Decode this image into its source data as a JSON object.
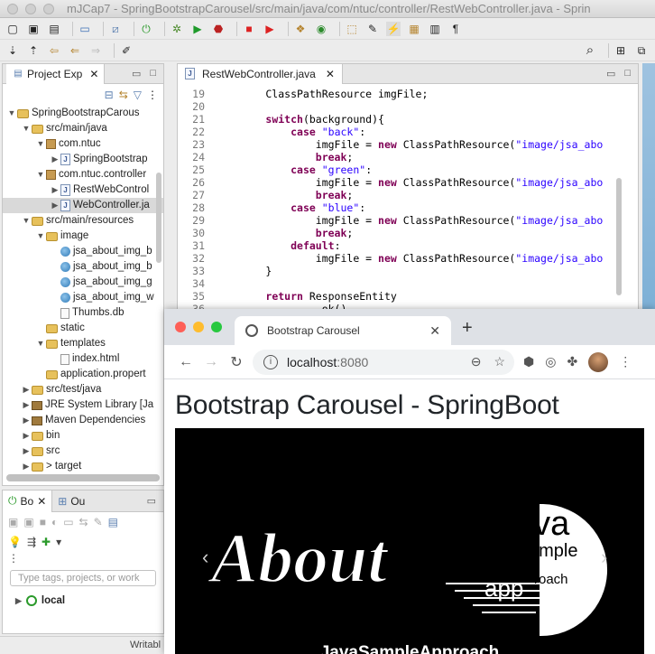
{
  "eclipse": {
    "window_title": "mJCap7 - SpringBootstrapCarousel/src/main/java/com/ntuc/controller/RestWebController.java - Sprin",
    "project_explorer": {
      "tab_label": "Project Exp",
      "items": [
        {
          "label": "SpringBootstrapCarous",
          "prefix": "> ",
          "level": 0,
          "expanded": true,
          "icon": "project-icon"
        },
        {
          "label": "src/main/java",
          "level": 1,
          "expanded": true,
          "icon": "source-folder-icon"
        },
        {
          "label": "com.ntuc",
          "level": 2,
          "expanded": true,
          "icon": "package-icon"
        },
        {
          "label": "SpringBootstrap",
          "level": 3,
          "expanded": false,
          "icon": "java-file-icon"
        },
        {
          "label": "com.ntuc.controller",
          "level": 2,
          "expanded": true,
          "icon": "package-icon"
        },
        {
          "label": "RestWebControl",
          "level": 3,
          "expanded": false,
          "icon": "java-file-icon"
        },
        {
          "label": "WebController.ja",
          "level": 3,
          "expanded": false,
          "icon": "java-file-icon",
          "selected": true
        },
        {
          "label": "src/main/resources",
          "level": 1,
          "expanded": true,
          "icon": "source-folder-icon"
        },
        {
          "label": "image",
          "level": 2,
          "expanded": true,
          "icon": "folder-icon"
        },
        {
          "label": "jsa_about_img_b",
          "level": 3,
          "icon": "image-file-icon"
        },
        {
          "label": "jsa_about_img_b",
          "level": 3,
          "icon": "image-file-icon"
        },
        {
          "label": "jsa_about_img_g",
          "level": 3,
          "icon": "image-file-icon"
        },
        {
          "label": "jsa_about_img_w",
          "level": 3,
          "icon": "image-file-icon"
        },
        {
          "label": "Thumbs.db",
          "level": 3,
          "icon": "db-file-icon"
        },
        {
          "label": "static",
          "level": 2,
          "icon": "folder-icon"
        },
        {
          "label": "templates",
          "level": 2,
          "expanded": true,
          "icon": "folder-icon"
        },
        {
          "label": "index.html",
          "level": 3,
          "icon": "html-file-icon"
        },
        {
          "label": "application.propert",
          "level": 2,
          "icon": "properties-icon"
        },
        {
          "label": "src/test/java",
          "level": 1,
          "expanded": false,
          "icon": "source-folder-icon"
        },
        {
          "label": "JRE System Library [Ja",
          "level": 1,
          "expanded": false,
          "icon": "library-icon"
        },
        {
          "label": "Maven Dependencies",
          "level": 1,
          "expanded": false,
          "icon": "library-icon"
        },
        {
          "label": "bin",
          "level": 1,
          "expanded": false,
          "icon": "folder-icon"
        },
        {
          "label": "src",
          "level": 1,
          "expanded": false,
          "icon": "folder-icon"
        },
        {
          "label": "> target",
          "level": 1,
          "expanded": false,
          "icon": "folder-icon"
        }
      ]
    },
    "boot_dashboard": {
      "tab_label": "Bo",
      "outline_tab_label": "Ou",
      "search_placeholder": "Type tags, projects, or work",
      "local_label": "local"
    },
    "status": "Writabl",
    "editor": {
      "tab_label": "RestWebController.java",
      "lines": [
        {
          "n": "19",
          "code": "        ClassPathResource imgFile;"
        },
        {
          "n": "20",
          "code": ""
        },
        {
          "n": "21",
          "code": "        switch(background){"
        },
        {
          "n": "22",
          "code": "            case \"back\":"
        },
        {
          "n": "23",
          "code": "                imgFile = new ClassPathResource(\"image/jsa_abo"
        },
        {
          "n": "24",
          "code": "                break;"
        },
        {
          "n": "25",
          "code": "            case \"green\":"
        },
        {
          "n": "26",
          "code": "                imgFile = new ClassPathResource(\"image/jsa_abo"
        },
        {
          "n": "27",
          "code": "                break;"
        },
        {
          "n": "28",
          "code": "            case \"blue\":"
        },
        {
          "n": "29",
          "code": "                imgFile = new ClassPathResource(\"image/jsa_abo"
        },
        {
          "n": "30",
          "code": "                break;"
        },
        {
          "n": "31",
          "code": "            default:"
        },
        {
          "n": "32",
          "code": "                imgFile = new ClassPathResource(\"image/jsa_abo"
        },
        {
          "n": "33",
          "code": "        }"
        },
        {
          "n": "34",
          "code": ""
        },
        {
          "n": "35",
          "code": "        return ResponseEntity"
        },
        {
          "n": "36",
          "code": "                .ok()"
        }
      ],
      "keywords": [
        "switch",
        "case",
        "new",
        "break",
        "default",
        "return"
      ]
    }
  },
  "chrome": {
    "tab_title": "Bootstrap Carousel",
    "url_host": "localhost",
    "url_port": ":8080",
    "page": {
      "heading": "Bootstrap Carousel - SpringBoot",
      "logo_word": "About",
      "logo_ava": "ava",
      "logo_ample": "ample",
      "logo_app": "app",
      "logo_roach": "roach",
      "caption": "JavaSampleApproach"
    }
  },
  "colors": {
    "eclipse_bg": "#ececec",
    "keyword": "#7f0055",
    "string": "#2a00ff",
    "chrome_tabbar": "#dee1e6",
    "carousel_bg": "#000000",
    "mac_red": "#fe5f57",
    "mac_yellow": "#febc2e",
    "mac_green": "#28c840"
  }
}
